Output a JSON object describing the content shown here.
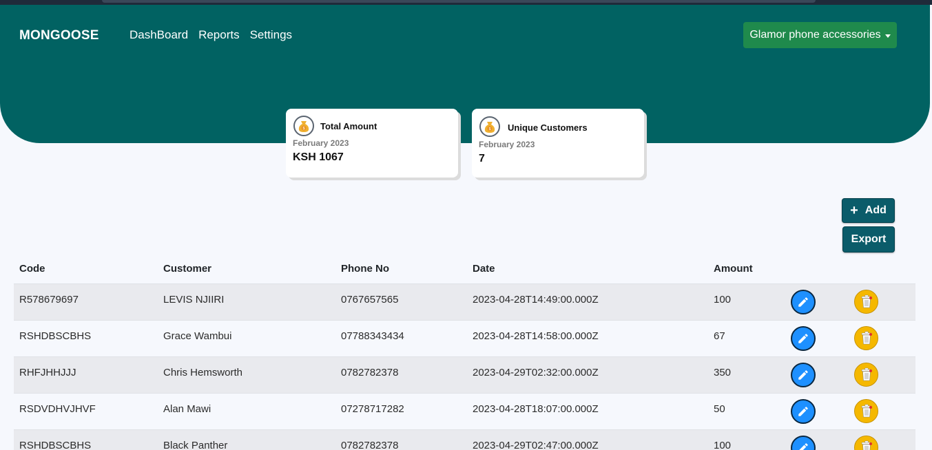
{
  "nav": {
    "brand": "MONGOOSE",
    "links": [
      "DashBoard",
      "Reports",
      "Settings"
    ],
    "store": "Glamor phone accessories"
  },
  "cards": [
    {
      "title": "Total Amount",
      "period": "February 2023",
      "value": "KSH 1067"
    },
    {
      "title": "Unique Customers",
      "period": "February 2023",
      "value": "7"
    }
  ],
  "actions": {
    "add": "Add",
    "export": "Export"
  },
  "table": {
    "headers": [
      "Code",
      "Customer",
      "Phone No",
      "Date",
      "Amount"
    ],
    "rows": [
      [
        "R578679697",
        "LEVIS NJIIRI",
        "0767657565",
        "2023-04-28T14:49:00.000Z",
        "100"
      ],
      [
        "RSHDBSCBHS",
        "Grace Wambui",
        "07788343434",
        "2023-04-28T14:58:00.000Z",
        "67"
      ],
      [
        "RHFJHHJJJ",
        "Chris Hemsworth",
        "0782782378",
        "2023-04-29T02:32:00.000Z",
        "350"
      ],
      [
        "RSDVDHVJHVF",
        "Alan Mawi",
        "07278717282",
        "2023-04-28T18:07:00.000Z",
        "50"
      ],
      [
        "RSHDBSCBHS",
        "Black Panther",
        "0782782378",
        "2023-04-29T02:47:00.000Z",
        "100"
      ]
    ]
  },
  "colors": {
    "header": "#016262",
    "store_button": "#1f8a4c",
    "action_button": "#0b5c6a",
    "edit": "#1e90ff",
    "delete": "#f5b800"
  }
}
